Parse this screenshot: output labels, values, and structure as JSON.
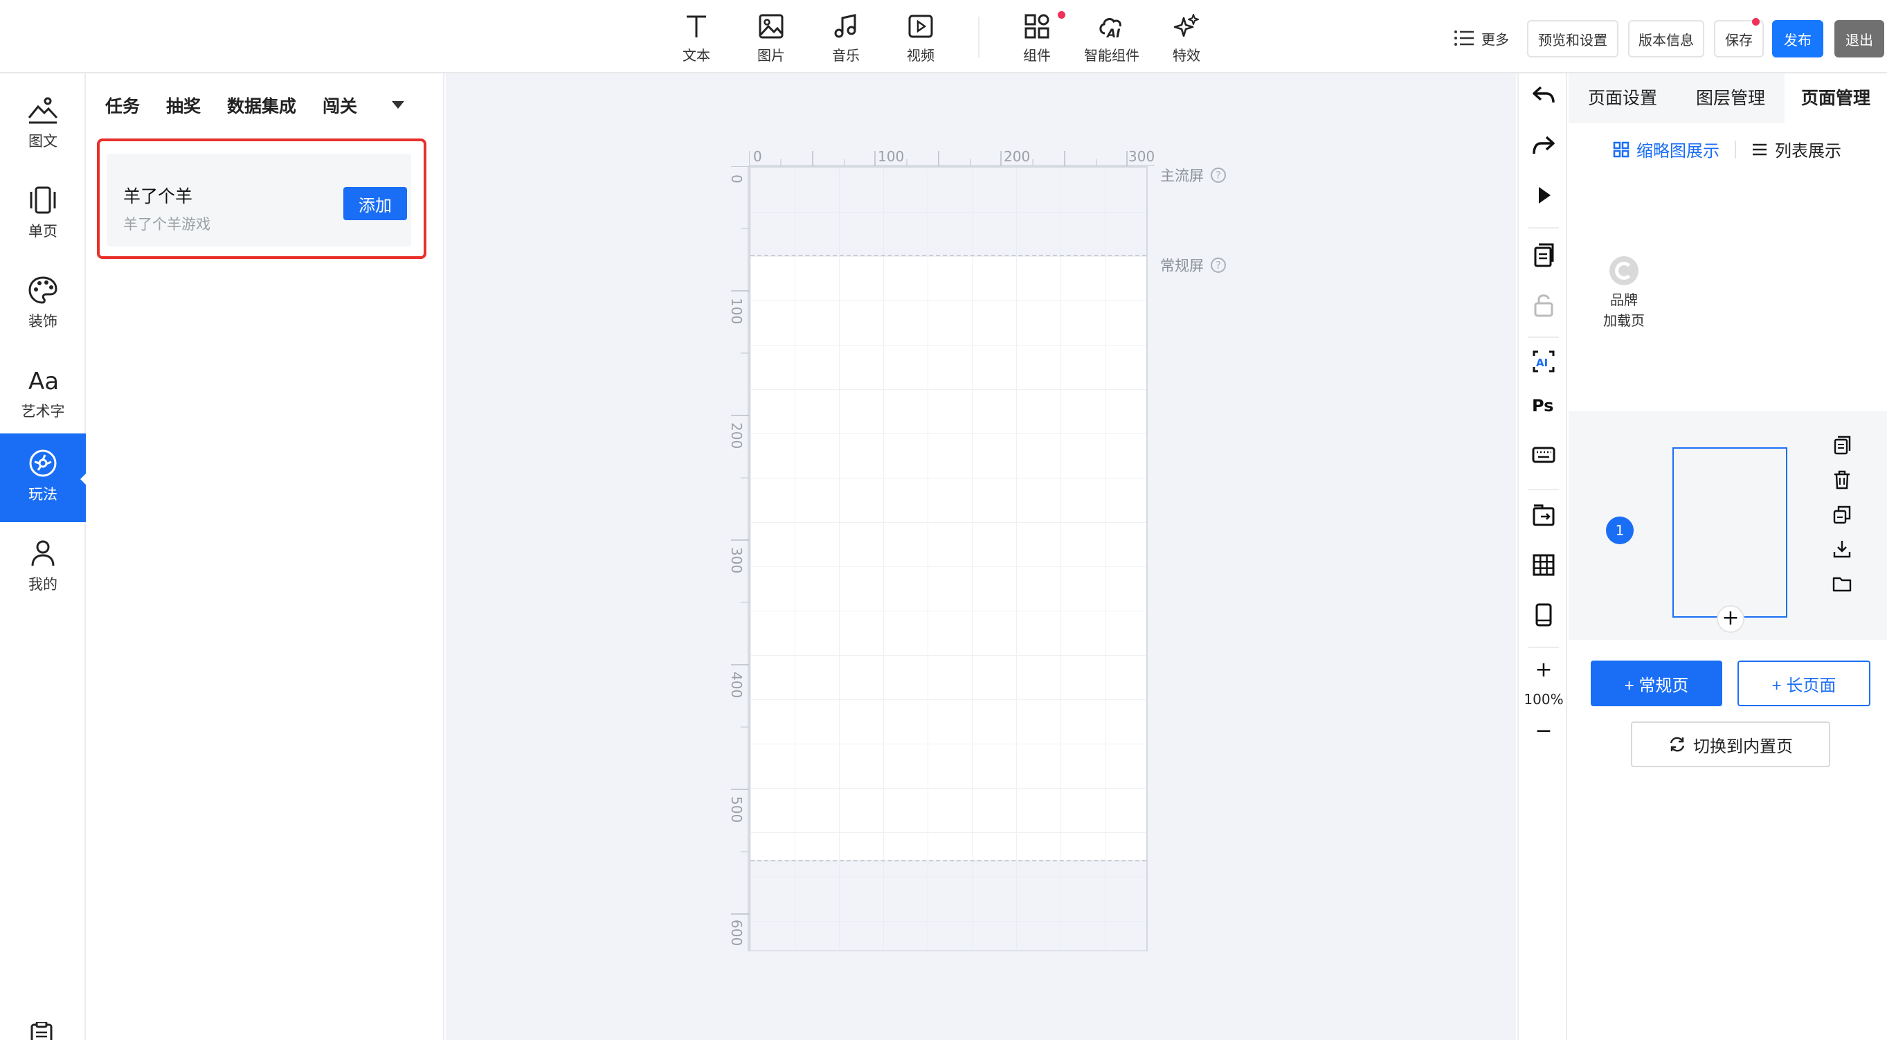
{
  "toolbar": {
    "tools": [
      {
        "label": "文本",
        "icon": "text-icon"
      },
      {
        "label": "图片",
        "icon": "image-icon"
      },
      {
        "label": "音乐",
        "icon": "music-icon"
      },
      {
        "label": "视频",
        "icon": "video-icon"
      },
      {
        "label": "组件",
        "icon": "components-icon",
        "has_badge": true
      },
      {
        "label": "智能组件",
        "icon": "ai-components-icon"
      },
      {
        "label": "特效",
        "icon": "sparkle-icon"
      }
    ],
    "more_label": "更多",
    "preview_label": "预览和设置",
    "version_label": "版本信息",
    "save_label": "保存",
    "save_has_badge": true,
    "publish_label": "发布",
    "exit_label": "退出",
    "badge_color": "#f0305a"
  },
  "left_rail": {
    "items": [
      {
        "label": "图文",
        "icon": "image-text-icon"
      },
      {
        "label": "单页",
        "icon": "single-page-icon"
      },
      {
        "label": "装饰",
        "icon": "palette-icon"
      },
      {
        "label": "艺术字",
        "icon": "art-text-icon"
      },
      {
        "label": "玩法",
        "icon": "gameplay-icon",
        "active": true
      },
      {
        "label": "我的",
        "icon": "user-icon"
      }
    ],
    "active_color": "#1a6ef5"
  },
  "panel": {
    "tabs": [
      "任务",
      "抽奖",
      "数据集成",
      "闯关"
    ],
    "card": {
      "title": "羊了个羊",
      "subtitle": "羊了个羊游戏",
      "add_label": "添加"
    },
    "highlight_color": "#e8302a"
  },
  "canvas": {
    "ruler_top": [
      "0",
      "100",
      "200",
      "300"
    ],
    "ruler_left": [
      "0",
      "100",
      "200",
      "300",
      "400",
      "500",
      "600"
    ],
    "main_screen_label": "主流屏",
    "normal_screen_label": "常规屏",
    "help_glyph": "?"
  },
  "vstrip": {
    "tools": [
      "undo-icon",
      "redo-icon",
      "play-icon",
      "copy-icon",
      "lock-icon",
      "ai-icon",
      "ps-icon",
      "keyboard-icon",
      "replace-icon",
      "grid-icon",
      "device-icon"
    ],
    "ps_label": "Ps",
    "zoom_in": "+",
    "zoom_level": "100%",
    "zoom_out": "−"
  },
  "right_panel": {
    "tabs": [
      "页面设置",
      "图层管理",
      "页面管理"
    ],
    "active_tab": "页面管理",
    "view_thumb_label": "缩略图展示",
    "view_list_label": "列表展示",
    "brand_page_lines": [
      "品牌",
      "加载页"
    ],
    "page_number": "1",
    "thumb_add": "+",
    "add_normal_label": "+ 常规页",
    "add_long_label": "+ 长页面",
    "switch_builtin_label": "切换到内置页",
    "accent": "#1a6ef5"
  }
}
